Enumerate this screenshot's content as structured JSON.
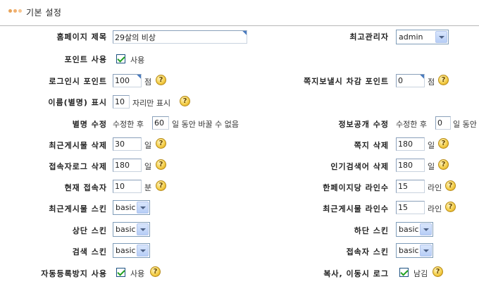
{
  "header": {
    "title": "기본 설정"
  },
  "colors": {
    "dot1": "#e8a45a",
    "dot2": "#f0b070",
    "dot3": "#f6c590",
    "rule": "#b8b8b8"
  },
  "icons": {
    "help": "help-question-icon",
    "check": "check-icon",
    "dropdown": "chevron-down-icon"
  },
  "help_glyph": "?",
  "left": {
    "homepage_title": {
      "label": "홈페이지 제목",
      "value": "29살의 비상"
    },
    "point_use": {
      "label": "포인트 사용",
      "checked": true,
      "check_label": "사용"
    },
    "login_point": {
      "label": "로그인시 포인트",
      "value": "100",
      "unit": "점"
    },
    "nickname_display": {
      "label": "이름(별명) 표시",
      "value": "10",
      "suffix": "자리만 표시"
    },
    "nickname_edit": {
      "label": "별명 수정",
      "prefix": "수정한 후",
      "value": "60",
      "suffix": "일 동안 바꿀 수 없음"
    },
    "recent_post_delete": {
      "label": "최근게시물 삭제",
      "value": "30",
      "unit": "일"
    },
    "access_log_delete": {
      "label": "접속자로그 삭제",
      "value": "180",
      "unit": "일"
    },
    "current_visitors": {
      "label": "현재 접속자",
      "value": "10",
      "unit": "분"
    },
    "recent_post_skin": {
      "label": "최근게시물 스킨",
      "value": "basic"
    },
    "top_skin": {
      "label": "상단 스킨",
      "value": "basic"
    },
    "search_skin": {
      "label": "검색 스킨",
      "value": "basic"
    },
    "captcha_use": {
      "label": "자동등록방지 사용",
      "checked": true,
      "check_label": "사용"
    }
  },
  "right": {
    "super_admin": {
      "label": "최고관리자",
      "value": "admin"
    },
    "memo_point": {
      "label": "쪽지보낼시 차감 포인트",
      "value": "0",
      "unit": "점"
    },
    "info_open_edit": {
      "label": "정보공개 수정",
      "prefix": "수정한 후",
      "value": "0",
      "suffix": "일 동안"
    },
    "memo_delete": {
      "label": "쪽지 삭제",
      "value": "180",
      "unit": "일"
    },
    "popular_search_delete": {
      "label": "인기검색어 삭제",
      "value": "180",
      "unit": "일"
    },
    "lines_per_page": {
      "label": "한페이지당 라인수",
      "value": "15",
      "unit": "라인"
    },
    "recent_post_lines": {
      "label": "최근게시물 라인수",
      "value": "15",
      "unit": "라인"
    },
    "bottom_skin": {
      "label": "하단 스킨",
      "value": "basic"
    },
    "visitor_skin": {
      "label": "접속자 스킨",
      "value": "basic"
    },
    "copy_move_log": {
      "label": "복사, 이동시 로그",
      "checked": true,
      "check_label": "남김"
    }
  }
}
